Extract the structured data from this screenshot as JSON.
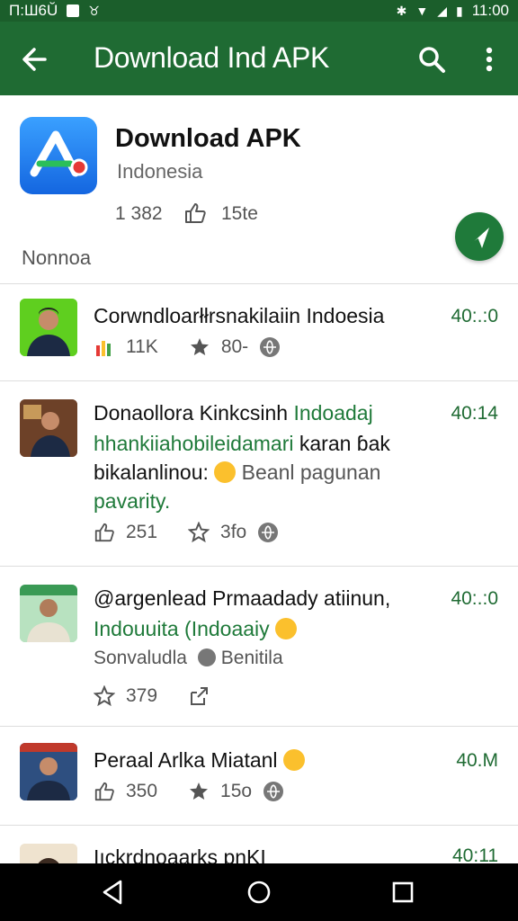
{
  "status_bar": {
    "left_text": "П:Ш6Ŭ",
    "time": "11:00"
  },
  "app_bar": {
    "title": "Download Ind APK"
  },
  "app_header": {
    "name": "Download APK",
    "region": "Indonesia",
    "count": "1 382",
    "likes": "15te",
    "section_label": "Nonnoa"
  },
  "feed": [
    {
      "lines": [
        "Corwndloarłłrsnakilaiin Indoesia"
      ],
      "time": "40:.:0",
      "meta": [
        "11K",
        "80-"
      ]
    },
    {
      "lines": [
        "Donaollora Kinkcsinh ",
        "Indoadaj",
        "hhankiiahobileidamari",
        " karan ɓak",
        "bikalanlinou:",
        " Beanl pagunan",
        "pavarity."
      ],
      "time": "40:14",
      "meta": [
        "251",
        "3fo"
      ]
    },
    {
      "lines": [
        "@argenlead Prmaadady atiinun,",
        "Indouuita (Indoaaiy",
        "Sonvaludla",
        "Benitila"
      ],
      "time": "40:.:0",
      "meta": [
        "379"
      ]
    },
    {
      "lines": [
        "Peraal Arlka Miatanl"
      ],
      "time": "40.M",
      "meta": [
        "350",
        "15o"
      ]
    },
    {
      "lines": [
        "Iıckrdnoaarks pnKI"
      ],
      "time": "40:11"
    }
  ],
  "colors": {
    "status_bar": "#1b5e2b",
    "app_bar": "#1f6b33",
    "accent": "#1f7a3a",
    "app_icon": "#2a8af5"
  }
}
